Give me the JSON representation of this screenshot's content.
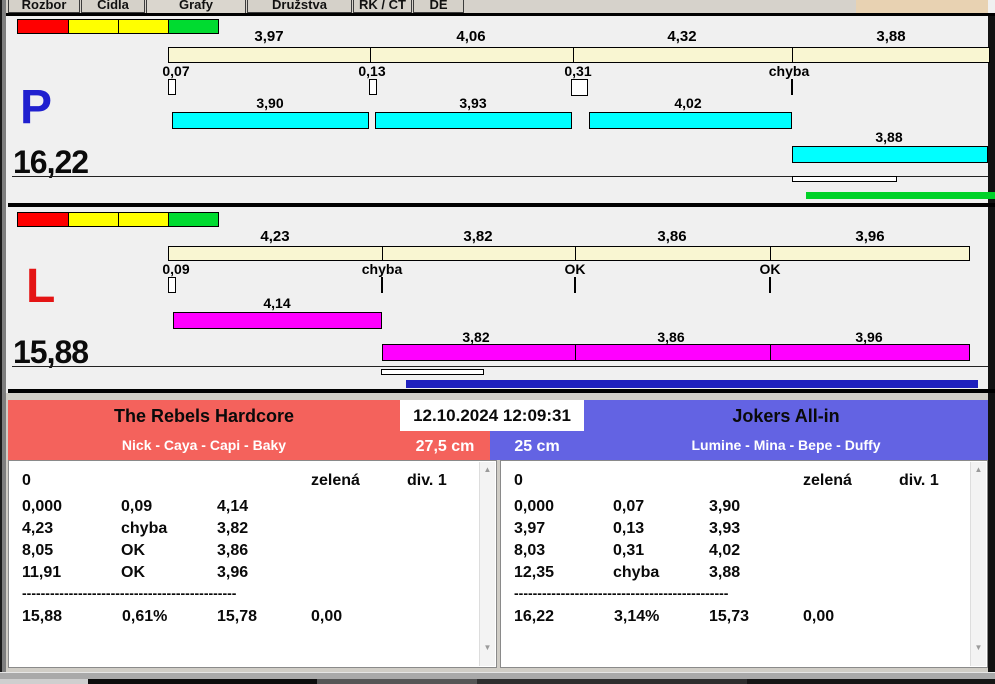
{
  "window": {
    "tabs": [
      {
        "label": "Rozbor"
      },
      {
        "label": "Čidla"
      },
      {
        "label": "Grafy"
      },
      {
        "label": "Družstva"
      },
      {
        "label": "RK / ČT"
      },
      {
        "label": "DE"
      }
    ],
    "active_tab": "Grafy"
  },
  "datetime": "12.10.2024 12:09:31",
  "colors": {
    "segment_red": "#ff0000",
    "segment_yellow": "#ffff00",
    "segment_green": "#00db30",
    "ruler_beige": "#f9f6d2",
    "bar_cyan": "#00ffff",
    "bar_magenta": "#ff00ff",
    "bar_blue": "#1f20bd",
    "bar_green": "#00d228",
    "team_red": "#f4625c",
    "team_blue": "#6363e3",
    "letter_p_blue": "#2020cf",
    "letter_l_red": "#e41414"
  },
  "icons": {
    "scroll_up": "▲",
    "scroll_down": "▼"
  },
  "lane_p": {
    "letter": "P",
    "total": "16,22",
    "ruler": [
      "3,97",
      "4,06",
      "4,32",
      "3,88"
    ],
    "markers": [
      "0,07",
      "0,13",
      "0,31",
      "chyba"
    ],
    "bars": [
      "3,90",
      "3,93",
      "4,02"
    ],
    "bar_last": "3,88"
  },
  "lane_l": {
    "letter": "L",
    "total": "15,88",
    "ruler": [
      "4,23",
      "3,82",
      "3,86",
      "3,96"
    ],
    "markers": [
      "0,09",
      "chyba",
      "OK",
      "OK"
    ],
    "bar_first": "4,14",
    "bars2": [
      "3,82",
      "3,86",
      "3,96"
    ]
  },
  "team_left": {
    "name": "The Rebels Hardcore",
    "members": "Nick - Caya - Capi - Baky",
    "distance": "27,5 cm",
    "log_start": "0",
    "log_status": "zelená",
    "log_division": "div. 1",
    "rows": [
      [
        "0,000",
        "0,09",
        "4,14"
      ],
      [
        "4,23",
        "chyba",
        "3,82"
      ],
      [
        "8,05",
        "OK",
        "3,86"
      ],
      [
        "11,91",
        "OK",
        "3,96"
      ]
    ],
    "separator": "----------------------------------------------",
    "totals": [
      "15,88",
      "0,61%",
      "15,78",
      "0,00"
    ]
  },
  "team_right": {
    "name": "Jokers All-in",
    "members": "Lumine - Mina - Bepe - Duffy",
    "distance": "25 cm",
    "log_start": "0",
    "log_status": "zelená",
    "log_division": "div. 1",
    "rows": [
      [
        "0,000",
        "0,07",
        "3,90"
      ],
      [
        "3,97",
        "0,13",
        "3,93"
      ],
      [
        "8,03",
        "0,31",
        "4,02"
      ],
      [
        "12,35",
        "chyba",
        "3,88"
      ]
    ],
    "separator": "----------------------------------------------",
    "totals": [
      "16,22",
      "3,14%",
      "15,73",
      "0,00"
    ]
  }
}
